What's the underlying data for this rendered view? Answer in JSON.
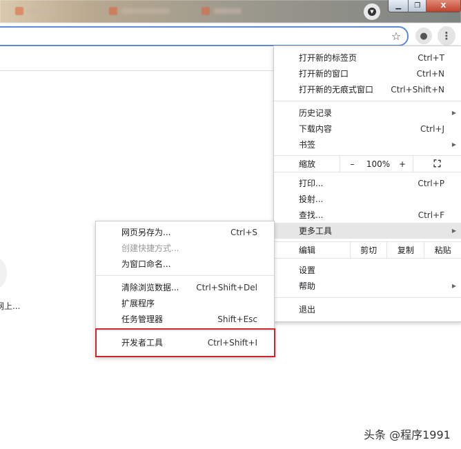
{
  "window": {
    "minimize": "▁",
    "restore": "❐",
    "close": "X"
  },
  "toolbar": {
    "star_icon": "☆",
    "profile_icon": "●",
    "menu_icon": "⋮"
  },
  "page": {
    "snippet": "网上..."
  },
  "main_menu": {
    "group1": [
      {
        "label": "打开新的标签页",
        "shortcut": "Ctrl+T"
      },
      {
        "label": "打开新的窗口",
        "shortcut": "Ctrl+N"
      },
      {
        "label": "打开新的无痕式窗口",
        "shortcut": "Ctrl+Shift+N"
      }
    ],
    "group2": [
      {
        "label": "历史记录",
        "shortcut": ""
      },
      {
        "label": "下载内容",
        "shortcut": "Ctrl+J"
      },
      {
        "label": "书签",
        "shortcut": ""
      }
    ],
    "zoom": {
      "label": "缩放",
      "minus": "–",
      "value": "100%",
      "plus": "+"
    },
    "group3": [
      {
        "label": "打印...",
        "shortcut": "Ctrl+P"
      },
      {
        "label": "投射...",
        "shortcut": ""
      },
      {
        "label": "查找...",
        "shortcut": "Ctrl+F"
      },
      {
        "label": "更多工具",
        "shortcut": ""
      }
    ],
    "edit": {
      "label": "编辑",
      "cut": "剪切",
      "copy": "复制",
      "paste": "粘贴"
    },
    "group4": [
      {
        "label": "设置"
      },
      {
        "label": "帮助"
      }
    ],
    "exit": "退出"
  },
  "sub_menu": {
    "group1": [
      {
        "label": "网页另存为...",
        "shortcut": "Ctrl+S"
      },
      {
        "label": "创建快捷方式...",
        "shortcut": ""
      },
      {
        "label": "为窗口命名...",
        "shortcut": ""
      }
    ],
    "group2": [
      {
        "label": "清除浏览数据...",
        "shortcut": "Ctrl+Shift+Del"
      },
      {
        "label": "扩展程序",
        "shortcut": ""
      },
      {
        "label": "任务管理器",
        "shortcut": "Shift+Esc"
      }
    ],
    "group3": [
      {
        "label": "开发者工具",
        "shortcut": "Ctrl+Shift+I"
      }
    ]
  },
  "watermark": "头条 @程序1991",
  "colors": {
    "highlight_box": "#d0232a",
    "address_border": "#5a8ad6"
  }
}
